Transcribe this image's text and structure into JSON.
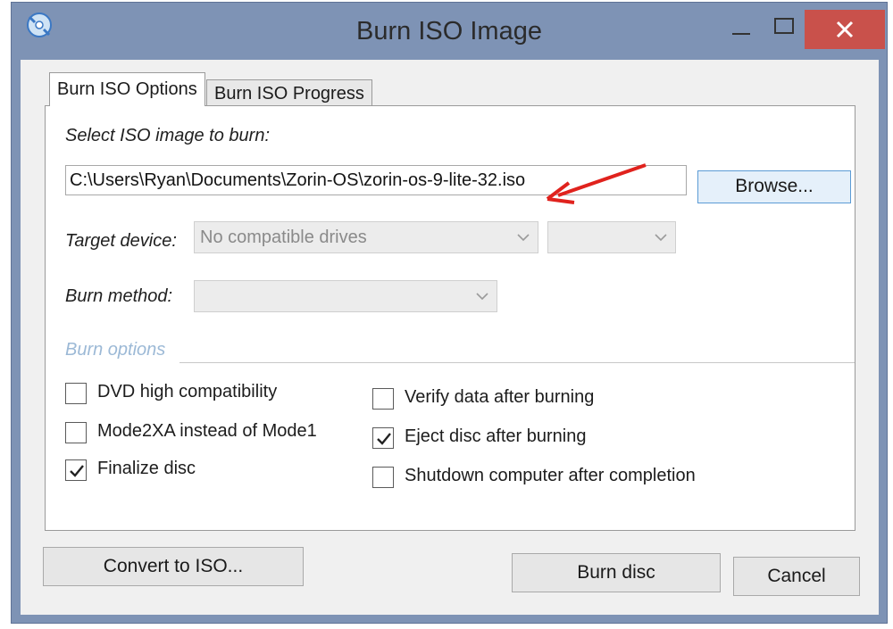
{
  "window": {
    "title": "Burn ISO Image",
    "icon": "disc-burn-icon",
    "titlebar_buttons": [
      "minimize-icon",
      "maximize-icon",
      "close-icon"
    ]
  },
  "tabs": [
    {
      "label": "Burn ISO Options",
      "active": true
    },
    {
      "label": "Burn ISO Progress",
      "active": false
    }
  ],
  "options": {
    "select_label": "Select ISO image to burn:",
    "iso_path": "C:\\Users\\Ryan\\Documents\\Zorin-OS\\zorin-os-9-lite-32.iso",
    "browse_label": "Browse...",
    "target_device_label": "Target device:",
    "target_device_value": "No compatible drives",
    "target_speed_value": "",
    "burn_method_label": "Burn method:",
    "burn_method_value": "",
    "burn_options_title": "Burn options"
  },
  "checkboxes": [
    {
      "label": "DVD high compatibility",
      "checked": false
    },
    {
      "label": "Mode2XA instead of Mode1",
      "checked": false
    },
    {
      "label": "Finalize disc",
      "checked": true
    },
    {
      "label": "Verify data after burning",
      "checked": false
    },
    {
      "label": "Eject disc after burning",
      "checked": true
    },
    {
      "label": "Shutdown computer after completion",
      "checked": false
    }
  ],
  "buttons": {
    "convert": "Convert to ISO...",
    "burn": "Burn disc",
    "cancel": "Cancel"
  },
  "colors": {
    "titlebar": "#7e93b5",
    "close_button": "#c9514b",
    "annotation_arrow": "#e0221d",
    "section_title": "#9cb9d6"
  }
}
